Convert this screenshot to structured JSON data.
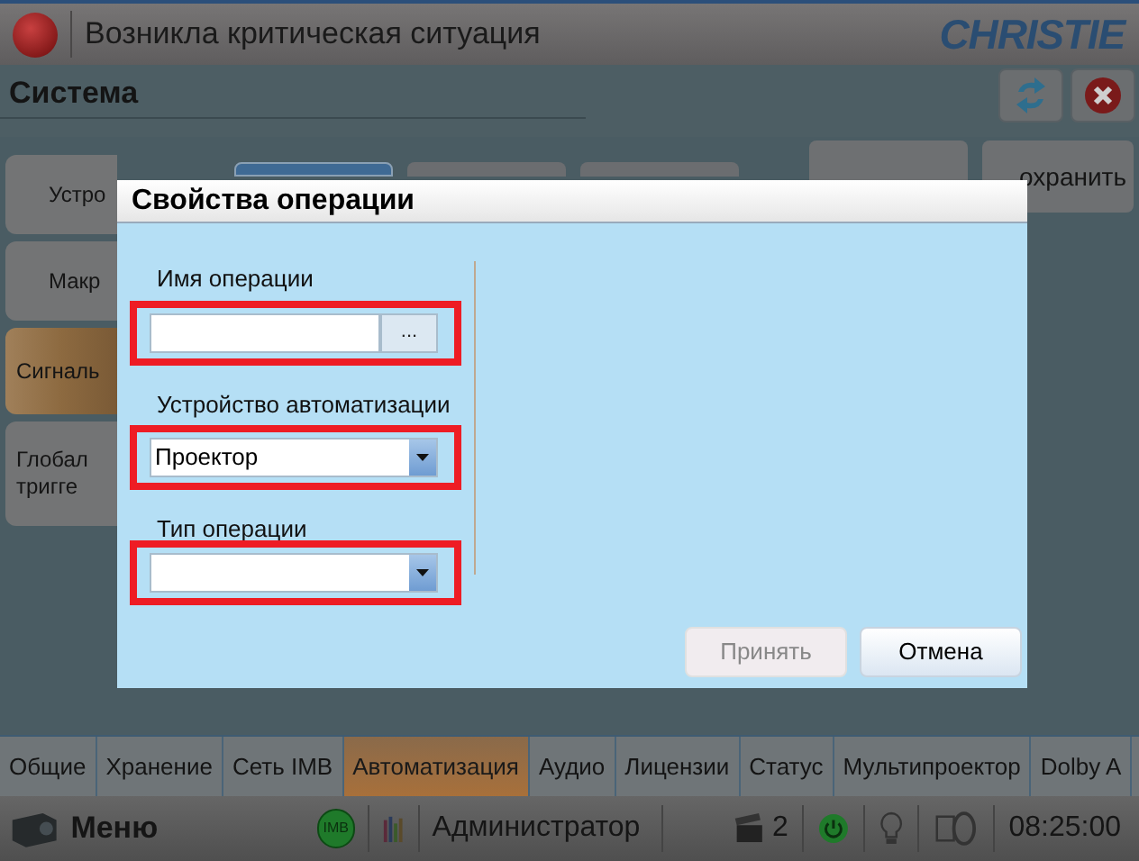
{
  "header": {
    "title": "Возникла критическая ситуация",
    "logo": "CHRISTIE"
  },
  "section": {
    "title": "Система"
  },
  "side_tabs": [
    {
      "label": "Устро",
      "selected": false
    },
    {
      "label": "Макр",
      "selected": false
    },
    {
      "label": "Сигналь",
      "selected": true
    },
    {
      "label": "Глобал\nтригге",
      "selected": false
    }
  ],
  "toolbar_tabs": [
    {
      "selected": true
    },
    {
      "selected": false
    },
    {
      "selected": false
    }
  ],
  "top_buttons": [
    {
      "label": "охранить"
    }
  ],
  "dialog": {
    "title": "Свойства операции",
    "fields": [
      {
        "kind": "browse",
        "label": "Имя операции",
        "browse": "...",
        "highlighted": true
      },
      {
        "kind": "dropdown",
        "label": "Устройство автоматизации",
        "value": "Проектор",
        "highlighted": true
      },
      {
        "kind": "dropdown",
        "label": "Тип операции",
        "highlighted": true
      }
    ],
    "buttons": [
      {
        "label": "Принять",
        "disabled": true
      },
      {
        "label": "Отмена",
        "disabled": false
      }
    ]
  },
  "bottom_tabs": [
    {
      "label": "Общие",
      "selected": false
    },
    {
      "label": "Хранение",
      "selected": false
    },
    {
      "label": "Сеть IMB",
      "selected": false
    },
    {
      "label": "Автоматизация",
      "selected": true
    },
    {
      "label": "Аудио",
      "selected": false
    },
    {
      "label": "Лицензии",
      "selected": false
    },
    {
      "label": "Статус",
      "selected": false
    },
    {
      "label": "Мультипроектор",
      "selected": false
    },
    {
      "label": "Dolby A",
      "selected": false
    }
  ],
  "status_bar": {
    "menu": "Меню",
    "imb": "IMB",
    "user": "Администратор",
    "count": "2",
    "time": "08:25:00"
  }
}
